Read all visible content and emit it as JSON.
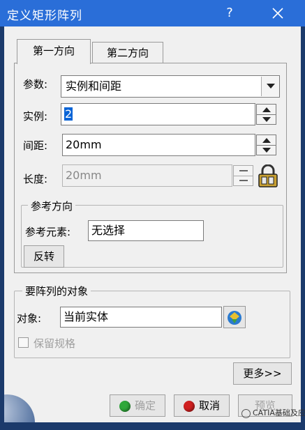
{
  "window": {
    "title": "定义矩形阵列",
    "help_label": "?"
  },
  "tabs": [
    {
      "label": "第一方向",
      "active": true
    },
    {
      "label": "第二方向",
      "active": false
    }
  ],
  "params": {
    "type_label": "参数:",
    "type_value": "实例和间距",
    "instances_label": "实例:",
    "instances_value": "2",
    "spacing_label": "间距:",
    "spacing_value": "20mm",
    "length_label": "长度:",
    "length_value": "20mm"
  },
  "ref_direction": {
    "group_title": "参考方向",
    "element_label": "参考元素:",
    "element_value": "无选择",
    "reverse_label": "反转"
  },
  "object": {
    "group_title": "要阵列的对象",
    "object_label": "对象:",
    "object_value": "当前实体",
    "keep_spec_label": "保留规格"
  },
  "buttons": {
    "more": "更多>>",
    "ok": "确定",
    "cancel": "取消",
    "preview": "预览"
  },
  "watermark": "CATIA基础及应用",
  "colors": {
    "titlebar": "#2a6ed8",
    "dialog_bg": "#f0f0f0",
    "selection": "#0a64d6",
    "ok_led": "#2fa83a",
    "cancel_led": "#d02020"
  }
}
